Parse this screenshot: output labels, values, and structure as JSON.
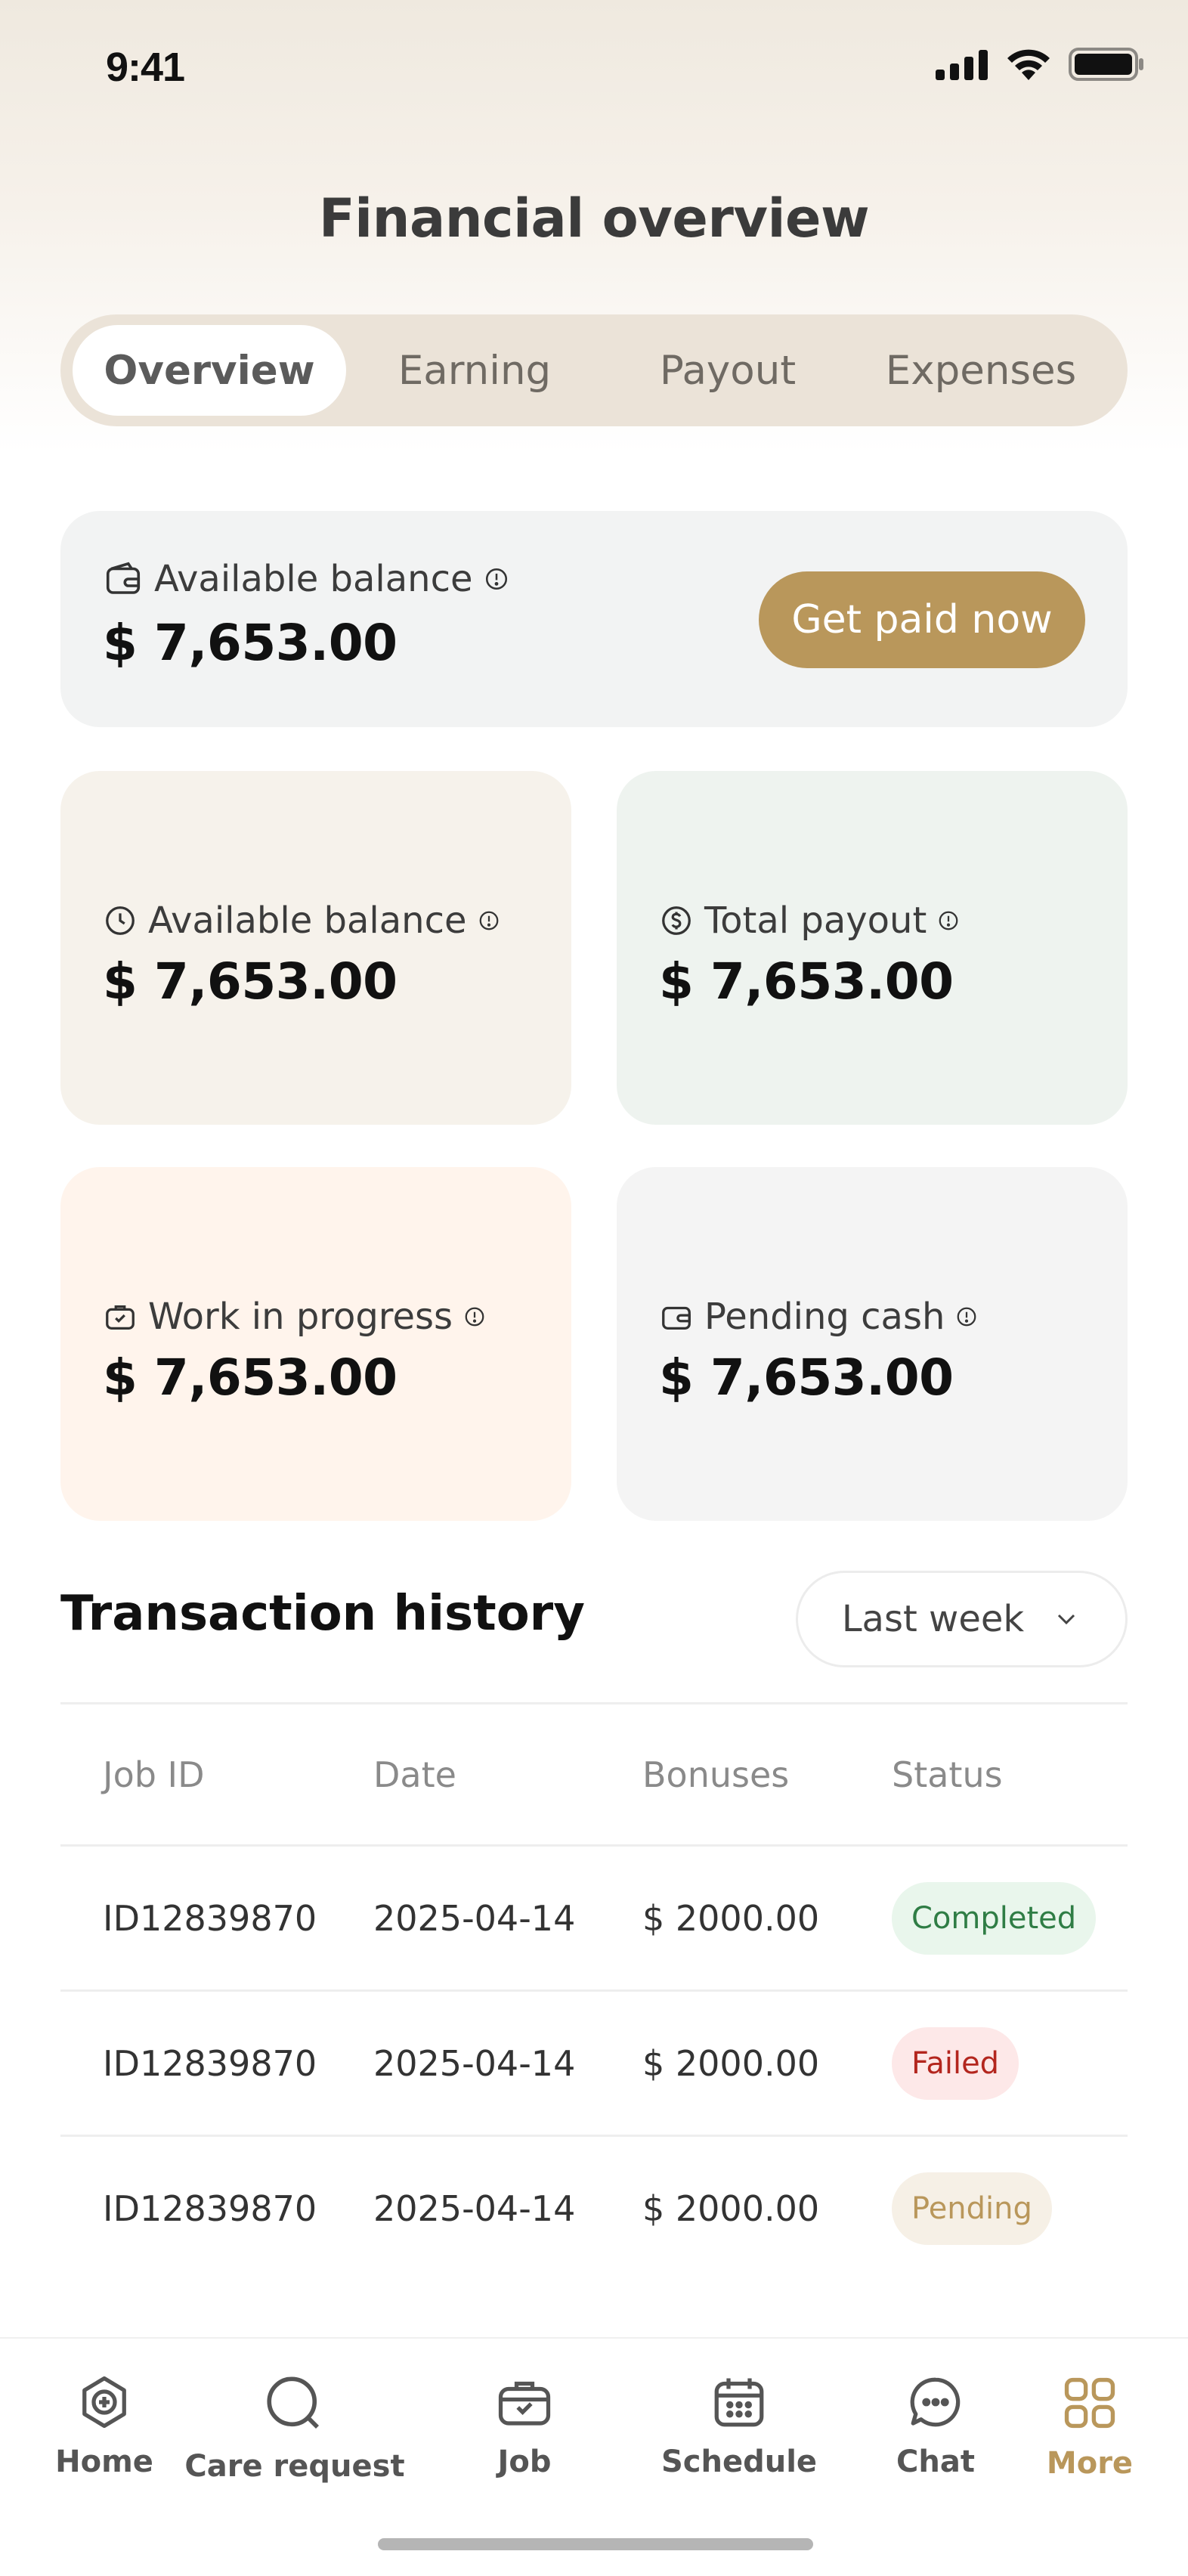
{
  "status_bar": {
    "time": "9:41"
  },
  "page_title": "Financial overview",
  "tabs": [
    {
      "label": "Overview",
      "active": true
    },
    {
      "label": "Earning",
      "active": false
    },
    {
      "label": "Payout",
      "active": false
    },
    {
      "label": "Expenses",
      "active": false
    }
  ],
  "balance_card": {
    "label": "Available balance",
    "amount": "$ 7,653.00",
    "button": "Get paid now",
    "icon": "wallet-icon"
  },
  "stats": [
    {
      "label": "Available balance",
      "amount": "$ 7,653.00",
      "icon": "clock-icon",
      "bg": "#f6f2eb"
    },
    {
      "label": "Total payout",
      "amount": "$ 7,653.00",
      "icon": "dollar-circle-icon",
      "bg": "#eef3ef"
    },
    {
      "label": "Work in progress",
      "amount": "$ 7,653.00",
      "icon": "briefcase-icon",
      "bg": "#fff4ec"
    },
    {
      "label": "Pending cash",
      "amount": "$ 7,653.00",
      "icon": "wallet-icon",
      "bg": "#f4f4f4"
    }
  ],
  "transactions": {
    "title": "Transaction history",
    "filter": "Last week",
    "columns": [
      "Job ID",
      "Date",
      "Bonuses",
      "Status"
    ],
    "rows": [
      {
        "job_id": "ID12839870",
        "date": "2025-04-14",
        "bonus": "$ 2000.00",
        "status": "Completed"
      },
      {
        "job_id": "ID12839870",
        "date": "2025-04-14",
        "bonus": "$ 2000.00",
        "status": "Failed"
      },
      {
        "job_id": "ID12839870",
        "date": "2025-04-14",
        "bonus": "$ 2000.00",
        "status": "Pending"
      }
    ]
  },
  "nav": [
    {
      "label": "Home",
      "icon": "home-icon",
      "active": false
    },
    {
      "label": "Care request",
      "icon": "search-icon",
      "active": false
    },
    {
      "label": "Job",
      "icon": "briefcase-icon",
      "active": false
    },
    {
      "label": "Schedule",
      "icon": "calendar-icon",
      "active": false
    },
    {
      "label": "Chat",
      "icon": "chat-icon",
      "active": false
    },
    {
      "label": "More",
      "icon": "grid-icon",
      "active": true
    }
  ],
  "colors": {
    "accent": "#b9975b",
    "completed_bg": "#e9f6ec",
    "completed_fg": "#2f7d45",
    "failed_bg": "#fde8e8",
    "failed_fg": "#b3261e",
    "pending_bg": "#f6f0e6",
    "pending_fg": "#b9975b"
  }
}
